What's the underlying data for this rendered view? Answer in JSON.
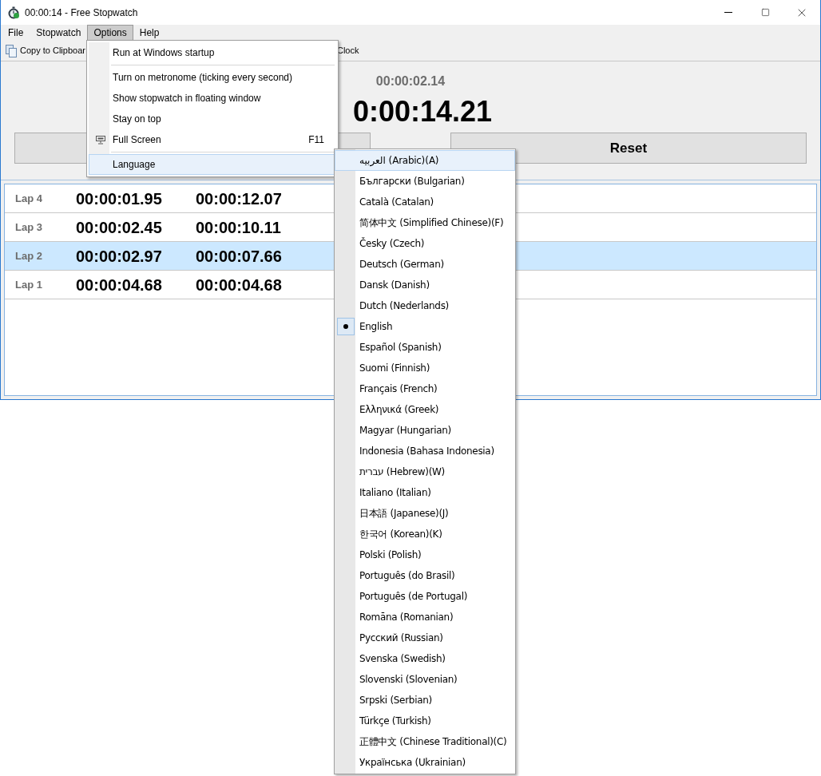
{
  "window": {
    "title": "00:00:14 - Free Stopwatch"
  },
  "menu_bar": [
    {
      "label": "File",
      "selected": false
    },
    {
      "label": "Stopwatch",
      "selected": false
    },
    {
      "label": "Options",
      "selected": true
    },
    {
      "label": "Help",
      "selected": false
    }
  ],
  "toolbar": [
    {
      "label": "Copy to Clipboar"
    },
    {
      "label": "Clock"
    }
  ],
  "display": {
    "lap_time": "00:00:02.14",
    "total_time": "0:00:14.21"
  },
  "reset_button": {
    "label": "Reset"
  },
  "laps": [
    {
      "label": "Lap 4",
      "lap_time": "00:00:01.95",
      "total_time": "00:00:12.07",
      "selected": false
    },
    {
      "label": "Lap 3",
      "lap_time": "00:00:02.45",
      "total_time": "00:00:10.11",
      "selected": false
    },
    {
      "label": "Lap 2",
      "lap_time": "00:00:02.97",
      "total_time": "00:00:07.66",
      "selected": true
    },
    {
      "label": "Lap 1",
      "lap_time": "00:00:04.68",
      "total_time": "00:00:04.68",
      "selected": false
    }
  ],
  "options_menu": {
    "items": [
      {
        "kind": "item",
        "label": "Run at Windows startup",
        "highlighted": false
      },
      {
        "kind": "separator"
      },
      {
        "kind": "item",
        "label": "Turn on metronome (ticking every second)",
        "highlighted": false
      },
      {
        "kind": "item",
        "label": "Show stopwatch in floating window",
        "highlighted": false
      },
      {
        "kind": "item",
        "label": "Stay on top",
        "highlighted": false
      },
      {
        "kind": "icon_item",
        "label": "Full Screen",
        "shortcut": "F11",
        "highlighted": false
      },
      {
        "kind": "separator"
      },
      {
        "kind": "item",
        "label": "Language",
        "highlighted": true
      }
    ]
  },
  "language_menu": {
    "items": [
      {
        "label": "العربيه (Arabic)(A)",
        "highlighted": true,
        "checked": false
      },
      {
        "label": "Български (Bulgarian)",
        "highlighted": false,
        "checked": false
      },
      {
        "label": "Català (Catalan)",
        "highlighted": false,
        "checked": false
      },
      {
        "label": "简体中文 (Simplified Chinese)(F)",
        "highlighted": false,
        "checked": false
      },
      {
        "label": "Česky (Czech)",
        "highlighted": false,
        "checked": false
      },
      {
        "label": "Deutsch (German)",
        "highlighted": false,
        "checked": false
      },
      {
        "label": "Dansk (Danish)",
        "highlighted": false,
        "checked": false
      },
      {
        "label": "Dutch (Nederlands)",
        "highlighted": false,
        "checked": false
      },
      {
        "label": "English",
        "highlighted": false,
        "checked": true
      },
      {
        "label": "Español (Spanish)",
        "highlighted": false,
        "checked": false
      },
      {
        "label": "Suomi (Finnish)",
        "highlighted": false,
        "checked": false
      },
      {
        "label": "Français (French)",
        "highlighted": false,
        "checked": false
      },
      {
        "label": "Ελληνικά (Greek)",
        "highlighted": false,
        "checked": false
      },
      {
        "label": "Magyar (Hungarian)",
        "highlighted": false,
        "checked": false
      },
      {
        "label": "Indonesia (Bahasa Indonesia)",
        "highlighted": false,
        "checked": false
      },
      {
        "label": "עברית (Hebrew)(W)",
        "highlighted": false,
        "checked": false
      },
      {
        "label": "Italiano (Italian)",
        "highlighted": false,
        "checked": false
      },
      {
        "label": "日本語 (Japanese)(J)",
        "highlighted": false,
        "checked": false
      },
      {
        "label": "한국어 (Korean)(K)",
        "highlighted": false,
        "checked": false
      },
      {
        "label": "Polski (Polish)",
        "highlighted": false,
        "checked": false
      },
      {
        "label": "Português (do Brasil)",
        "highlighted": false,
        "checked": false
      },
      {
        "label": "Português (de Portugal)",
        "highlighted": false,
        "checked": false
      },
      {
        "label": "Romāna (Romanian)",
        "highlighted": false,
        "checked": false
      },
      {
        "label": "Русский (Russian)",
        "highlighted": false,
        "checked": false
      },
      {
        "label": "Svenska (Swedish)",
        "highlighted": false,
        "checked": false
      },
      {
        "label": "Slovenski (Slovenian)",
        "highlighted": false,
        "checked": false
      },
      {
        "label": "Srpski (Serbian)",
        "highlighted": false,
        "checked": false
      },
      {
        "label": "Türkçe (Turkish)",
        "highlighted": false,
        "checked": false
      },
      {
        "label": "正體中文 (Chinese Traditional)(C)",
        "highlighted": false,
        "checked": false
      },
      {
        "label": "Українська (Ukrainian)",
        "highlighted": false,
        "checked": false
      }
    ]
  }
}
